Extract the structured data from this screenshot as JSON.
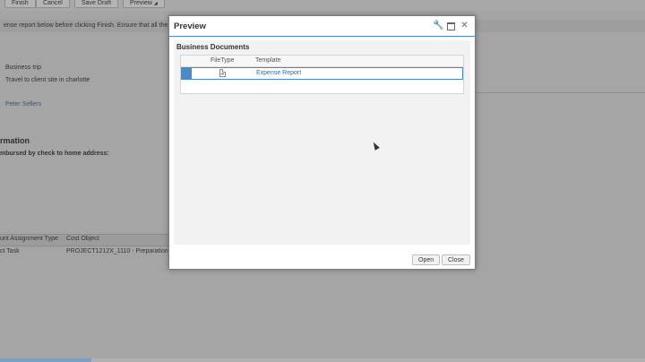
{
  "toolbar": {
    "finish": "Finish",
    "cancel": "Cancel",
    "save_draft": "Save Draft",
    "preview": "Preview"
  },
  "background": {
    "message": "ense report below before clicking Finish. Ensure that all the da",
    "trip_type": "Business trip",
    "trip_purpose": "Travel to client site in charlotte",
    "approver": "Peter Sellers",
    "section_heading": "rmation",
    "reimburse_label": "mbursed by check to home address:",
    "table": {
      "columns": [
        "unt Assignment Type",
        "Cost Object"
      ],
      "row": [
        "ct Task",
        "PROJECT1212X_1110 - Preparation"
      ]
    }
  },
  "dialog": {
    "title": "Preview",
    "section_title": "Business Documents",
    "columns": {
      "file_type": "FileType",
      "template": "Template"
    },
    "rows": [
      {
        "file_type_icon": "document-icon",
        "template": "Expense Report"
      }
    ],
    "buttons": {
      "open": "Open",
      "close": "Close"
    }
  },
  "colors": {
    "accent": "#4a8bc7",
    "link": "#2f6da3",
    "overlay": "#a5a5a5"
  }
}
